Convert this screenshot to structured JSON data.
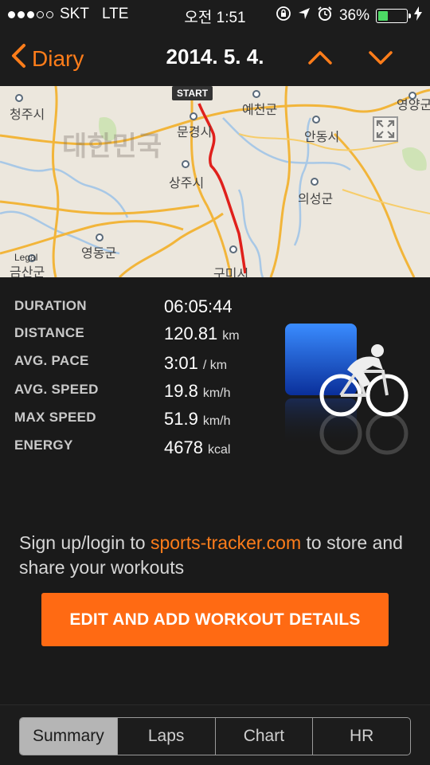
{
  "status_bar": {
    "carrier": "SKT",
    "network": "LTE",
    "time": "오전 1:51",
    "battery": "36%",
    "battery_level": 0.36,
    "signal_bars_filled": 3,
    "signal_bars_total": 5
  },
  "nav": {
    "back_label": "Diary",
    "title": "2014. 5. 4."
  },
  "map": {
    "start_label": "START",
    "legal": "Legal",
    "labels": {
      "country": "대한민국",
      "cheongju": "청주시",
      "mungyeong": "문경시",
      "yecheon": "예천군",
      "yeongyang": "영양군",
      "andong": "안동시",
      "sangju": "상주시",
      "uiseong": "의성군",
      "yeongdong": "영동군",
      "gumi": "구미시",
      "geumsan": "금산군"
    },
    "route_color": "#e0201c"
  },
  "stats": [
    {
      "label": "DURATION",
      "value": "06:05:44",
      "unit": ""
    },
    {
      "label": "DISTANCE",
      "value": "120.81",
      "unit": "km"
    },
    {
      "label": "AVG. PACE",
      "value": "3:01",
      "unit": "/ km"
    },
    {
      "label": "AVG. SPEED",
      "value": "19.8",
      "unit": "km/h"
    },
    {
      "label": "MAX SPEED",
      "value": "51.9",
      "unit": "km/h"
    },
    {
      "label": "ENERGY",
      "value": "4678",
      "unit": "kcal"
    }
  ],
  "sport_icon": "cycling-icon",
  "promo": {
    "prefix": "Sign up/login to ",
    "link": "sports-tracker.com",
    "suffix": " to store and share your workouts"
  },
  "edit_button_label": "EDIT AND ADD WORKOUT DETAILS",
  "tabs": [
    {
      "label": "Summary",
      "active": true
    },
    {
      "label": "Laps",
      "active": false
    },
    {
      "label": "Chart",
      "active": false
    },
    {
      "label": "HR",
      "active": false
    }
  ],
  "colors": {
    "accent": "#ff7d1a",
    "button": "#ff6a13",
    "background": "#1a1a1a"
  }
}
